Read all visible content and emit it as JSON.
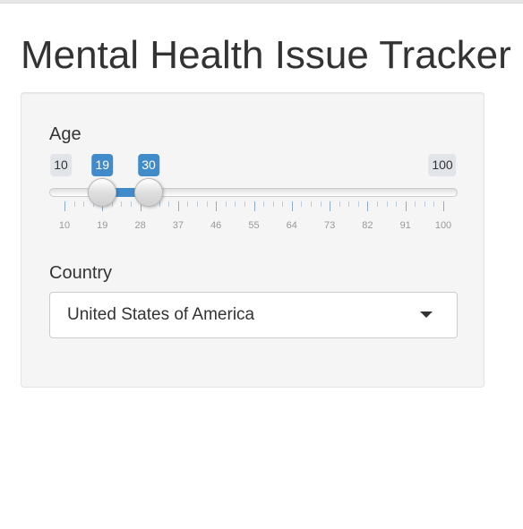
{
  "app": {
    "title": "Mental Health Issue Tracker"
  },
  "age_slider": {
    "label": "Age",
    "min": 10,
    "max": 100,
    "from": 19,
    "to": 30,
    "min_label": "10",
    "max_label": "100",
    "from_label": "19",
    "to_label": "30",
    "tick_labels": [
      "10",
      "19",
      "28",
      "37",
      "46",
      "55",
      "64",
      "73",
      "82",
      "91",
      "100"
    ],
    "accent_color": "#428bca"
  },
  "country_select": {
    "label": "Country",
    "selected": "United States of America"
  }
}
